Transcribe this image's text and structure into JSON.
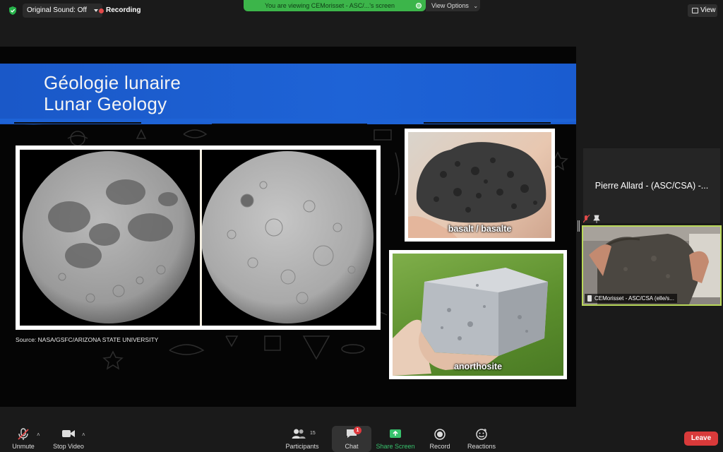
{
  "topbar": {
    "audio_label": "Original Sound: Off",
    "recording_label": "Recording",
    "viewing_banner": "You are viewing CEMorisset - ASC/...'s screen",
    "view_options_label": "View Options",
    "view_label": "View"
  },
  "slide": {
    "title_fr": "Géologie lunaire",
    "title_en": "Lunar Geology",
    "source": "Source: NASA/GSFC/ARIZONA STATE UNIVERSITY",
    "rock1_label": "basalt / basalte",
    "rock2_label": "anorthosite"
  },
  "participants": {
    "tile_name": "Pierre Allard - (ASC/CSA) -...",
    "video_caption": "CEMorisset - ASC/CSA (elle/s..."
  },
  "toolbar": {
    "unmute": "Unmute",
    "stop_video": "Stop Video",
    "participants": "Participants",
    "participants_count": "15",
    "chat": "Chat",
    "chat_badge": "1",
    "share_screen": "Share Screen",
    "record": "Record",
    "reactions": "Reactions",
    "leave": "Leave"
  },
  "colors": {
    "accent_green": "#3cb54a",
    "share_green": "#38c26d",
    "leave_red": "#d93a3a",
    "banner_blue": "#1e63d6",
    "active_speaker": "#b9d85a"
  },
  "icons": [
    "shield-icon",
    "recording-dot-icon",
    "view-icon",
    "mic-muted-icon",
    "video-camera-icon",
    "participants-icon",
    "chat-icon",
    "share-screen-icon",
    "record-icon",
    "reactions-icon"
  ]
}
